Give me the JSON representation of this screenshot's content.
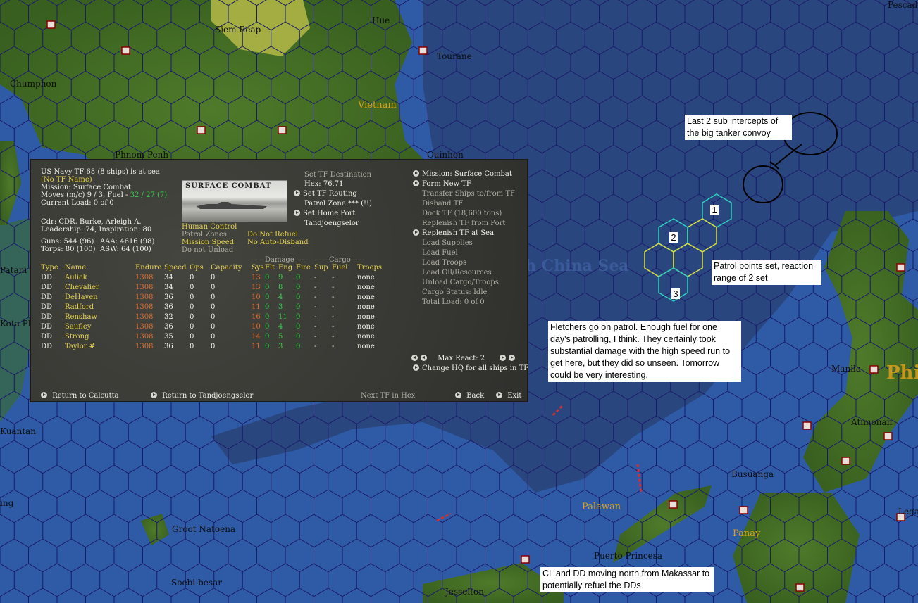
{
  "map": {
    "places": [
      {
        "name": "Siem Reap",
        "style": "light"
      },
      {
        "name": "Hue",
        "style": "light"
      },
      {
        "name": "Tourane",
        "style": "light"
      },
      {
        "name": "Chumphon",
        "style": "light"
      },
      {
        "name": "Vietnam",
        "style": "gold"
      },
      {
        "name": "Phnom Penh",
        "style": "light"
      },
      {
        "name": "Quinhon",
        "style": "light"
      },
      {
        "name": "Pescad",
        "style": "light"
      },
      {
        "name": "Manila",
        "style": "light"
      },
      {
        "name": "Phi",
        "style": "big"
      },
      {
        "name": "Atimonan",
        "style": "light"
      },
      {
        "name": "Busuanga",
        "style": "light"
      },
      {
        "name": "Palawan",
        "style": "gold"
      },
      {
        "name": "Panay",
        "style": "gold"
      },
      {
        "name": "Lega",
        "style": "light"
      },
      {
        "name": "Puerto Princesa",
        "style": "light"
      },
      {
        "name": "Groot Natoena",
        "style": "light"
      },
      {
        "name": "Soebi-besar",
        "style": "light"
      },
      {
        "name": "Jesselton",
        "style": "light"
      },
      {
        "name": "Kuantan",
        "style": "light"
      },
      {
        "name": "Kota Ph",
        "style": "light"
      },
      {
        "name": "Patani",
        "style": "light"
      },
      {
        "name": "ing",
        "style": "light"
      },
      {
        "name": "h China Sea",
        "style": "sea"
      }
    ],
    "hex_labels": [
      "1",
      "2",
      "3"
    ],
    "notes": {
      "sub_intercepts": "Last 2 sub intercepts of the big tanker convoy",
      "patrol_points": "Patrol points set, reaction range of 2 set",
      "fletchers": "Fletchers go on patrol.  Enough fuel for one day's patrolling, I think.  They certainly took substantial damage with the high speed run to get here, but they did so unseen.  Tomorrow could be very interesting.",
      "cl_dd": "CL and DD moving north from Makassar to potentially refuel the DDs"
    }
  },
  "panel": {
    "header": {
      "line1": "US Navy TF 68 (8 ships) is at sea",
      "tf_name": "(No TF Name)",
      "mission": "Mission: Surface Combat",
      "moves_prefix": "Moves (m/c) 9 / 3, Fuel - ",
      "moves_fuel": "32 / 27 (7)",
      "load": "Current Load: 0 of 0",
      "cdr": "Cdr: CDR. Burke, Arleigh A.",
      "leadership": "Leadership: 74, Inspiration: 80",
      "guns": "Guns: 544 (96)",
      "torps": "Torps: 80 (100)",
      "aaa": "AAA: 4616 (98)",
      "asw": "ASW: 64 (100)"
    },
    "photo_label": "SURFACE COMBAT",
    "controls": {
      "human_control": "Human Control",
      "patrol_zones": "Patrol Zones",
      "mission_speed": "Mission Speed",
      "do_not_unload": "Do not Unload",
      "do_not_refuel": "Do Not Refuel",
      "no_auto_disband": "No Auto-Disband"
    },
    "destination": {
      "set_dest": "Set TF Destination",
      "hex": "Hex: 76,71",
      "routing": "Set TF Routing",
      "patrol_zone": "Patrol Zone *** (!!)",
      "home_port": "Set Home Port",
      "home_port_name": "Tandjoengselor"
    },
    "menu": [
      {
        "label": "Mission: Surface Combat",
        "arrow": true,
        "active": true
      },
      {
        "label": "Form New TF",
        "arrow": true,
        "active": true
      },
      {
        "label": "Transfer Ships to/from TF",
        "arrow": false,
        "active": false
      },
      {
        "label": "Disband TF",
        "arrow": false,
        "active": false
      },
      {
        "label": "Dock TF (18,600 tons)",
        "arrow": false,
        "active": false
      },
      {
        "label": "Replenish TF from Port",
        "arrow": false,
        "active": false
      },
      {
        "label": "Replenish TF at Sea",
        "arrow": true,
        "active": true
      },
      {
        "label": "Load Supplies",
        "arrow": false,
        "active": false
      },
      {
        "label": "Load Fuel",
        "arrow": false,
        "active": false
      },
      {
        "label": "Load Troops",
        "arrow": false,
        "active": false
      },
      {
        "label": "Load Oil/Resources",
        "arrow": false,
        "active": false
      },
      {
        "label": "Unload Cargo/Troops",
        "arrow": false,
        "active": false
      },
      {
        "label": "Cargo Status: Idle",
        "arrow": false,
        "active": false
      },
      {
        "label": "Total Load: 0 of 0",
        "arrow": false,
        "active": false
      }
    ],
    "table": {
      "group_damage": "Damage",
      "group_cargo": "Cargo",
      "headers": [
        "Type",
        "Name",
        "Endure",
        "Speed",
        "Ops",
        "Capacity",
        "Sys",
        "Flt",
        "Eng",
        "Fire",
        "Sup",
        "Fuel",
        "Troops"
      ],
      "rows": [
        [
          "DD",
          "Aulick",
          "1308",
          "34",
          "0",
          "0",
          "13",
          "0",
          "9",
          "0",
          "-",
          "-",
          "none"
        ],
        [
          "DD",
          "Chevalier",
          "1308",
          "34",
          "0",
          "0",
          "13",
          "0",
          "8",
          "0",
          "-",
          "-",
          "none"
        ],
        [
          "DD",
          "DeHaven",
          "1308",
          "36",
          "0",
          "0",
          "10",
          "0",
          "4",
          "0",
          "-",
          "-",
          "none"
        ],
        [
          "DD",
          "Radford",
          "1308",
          "36",
          "0",
          "0",
          "11",
          "0",
          "3",
          "0",
          "-",
          "-",
          "none"
        ],
        [
          "DD",
          "Renshaw",
          "1308",
          "32",
          "0",
          "0",
          "16",
          "0",
          "11",
          "0",
          "-",
          "-",
          "none"
        ],
        [
          "DD",
          "Saufley",
          "1308",
          "36",
          "0",
          "0",
          "10",
          "0",
          "4",
          "0",
          "-",
          "-",
          "none"
        ],
        [
          "DD",
          "Strong",
          "1308",
          "35",
          "0",
          "0",
          "14",
          "0",
          "5",
          "0",
          "-",
          "-",
          "none"
        ],
        [
          "DD",
          "Taylor #",
          "1308",
          "36",
          "0",
          "0",
          "11",
          "0",
          "3",
          "0",
          "-",
          "-",
          "none"
        ]
      ]
    },
    "max_react": "Max React: 2",
    "change_hq": "Change HQ for all ships in TF",
    "footer": {
      "return_calcutta": "Return to Calcutta",
      "return_tandj": "Return to Tandjoengselor",
      "next_tf": "Next TF in Hex",
      "back": "Back",
      "exit": "Exit"
    }
  }
}
